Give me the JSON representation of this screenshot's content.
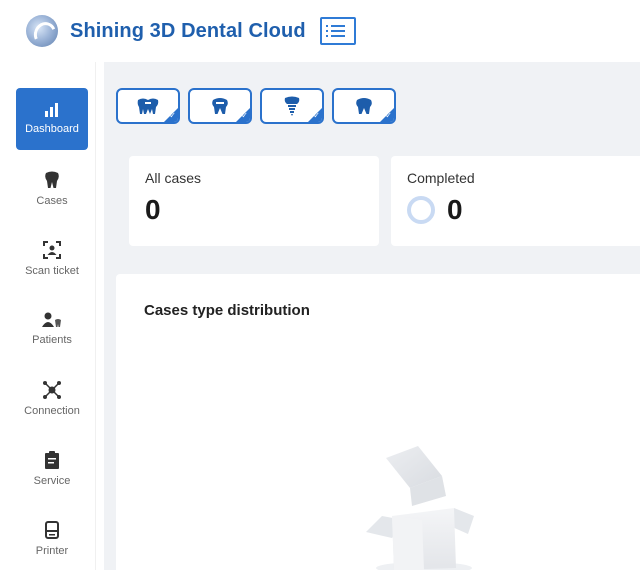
{
  "app": {
    "title": "Shining 3D Dental Cloud"
  },
  "sidebar": {
    "items": [
      {
        "label": "Dashboard",
        "icon": "bar-chart-icon",
        "active": true
      },
      {
        "label": "Cases",
        "icon": "tooth-icon",
        "active": false
      },
      {
        "label": "Scan ticket",
        "icon": "scan-ticket-icon",
        "active": false
      },
      {
        "label": "Patients",
        "icon": "patients-icon",
        "active": false
      },
      {
        "label": "Connection",
        "icon": "connection-icon",
        "active": false
      },
      {
        "label": "Service",
        "icon": "clipboard-icon",
        "active": false
      },
      {
        "label": "Printer",
        "icon": "printer-icon",
        "active": false
      }
    ]
  },
  "case_type_filters": [
    {
      "icon": "bridge-tooth-icon",
      "selected": true
    },
    {
      "icon": "crown-tooth-icon",
      "selected": true
    },
    {
      "icon": "implant-tooth-icon",
      "selected": true
    },
    {
      "icon": "single-tooth-icon",
      "selected": true
    }
  ],
  "stats": {
    "all_cases": {
      "label": "All cases",
      "value": "0"
    },
    "completed": {
      "label": "Completed",
      "value": "0"
    }
  },
  "distribution": {
    "title": "Cases type distribution"
  },
  "colors": {
    "brand": "#1f5fad",
    "accent": "#2b72cc",
    "background": "#f0f2f5",
    "ring": "#c9daf3"
  }
}
